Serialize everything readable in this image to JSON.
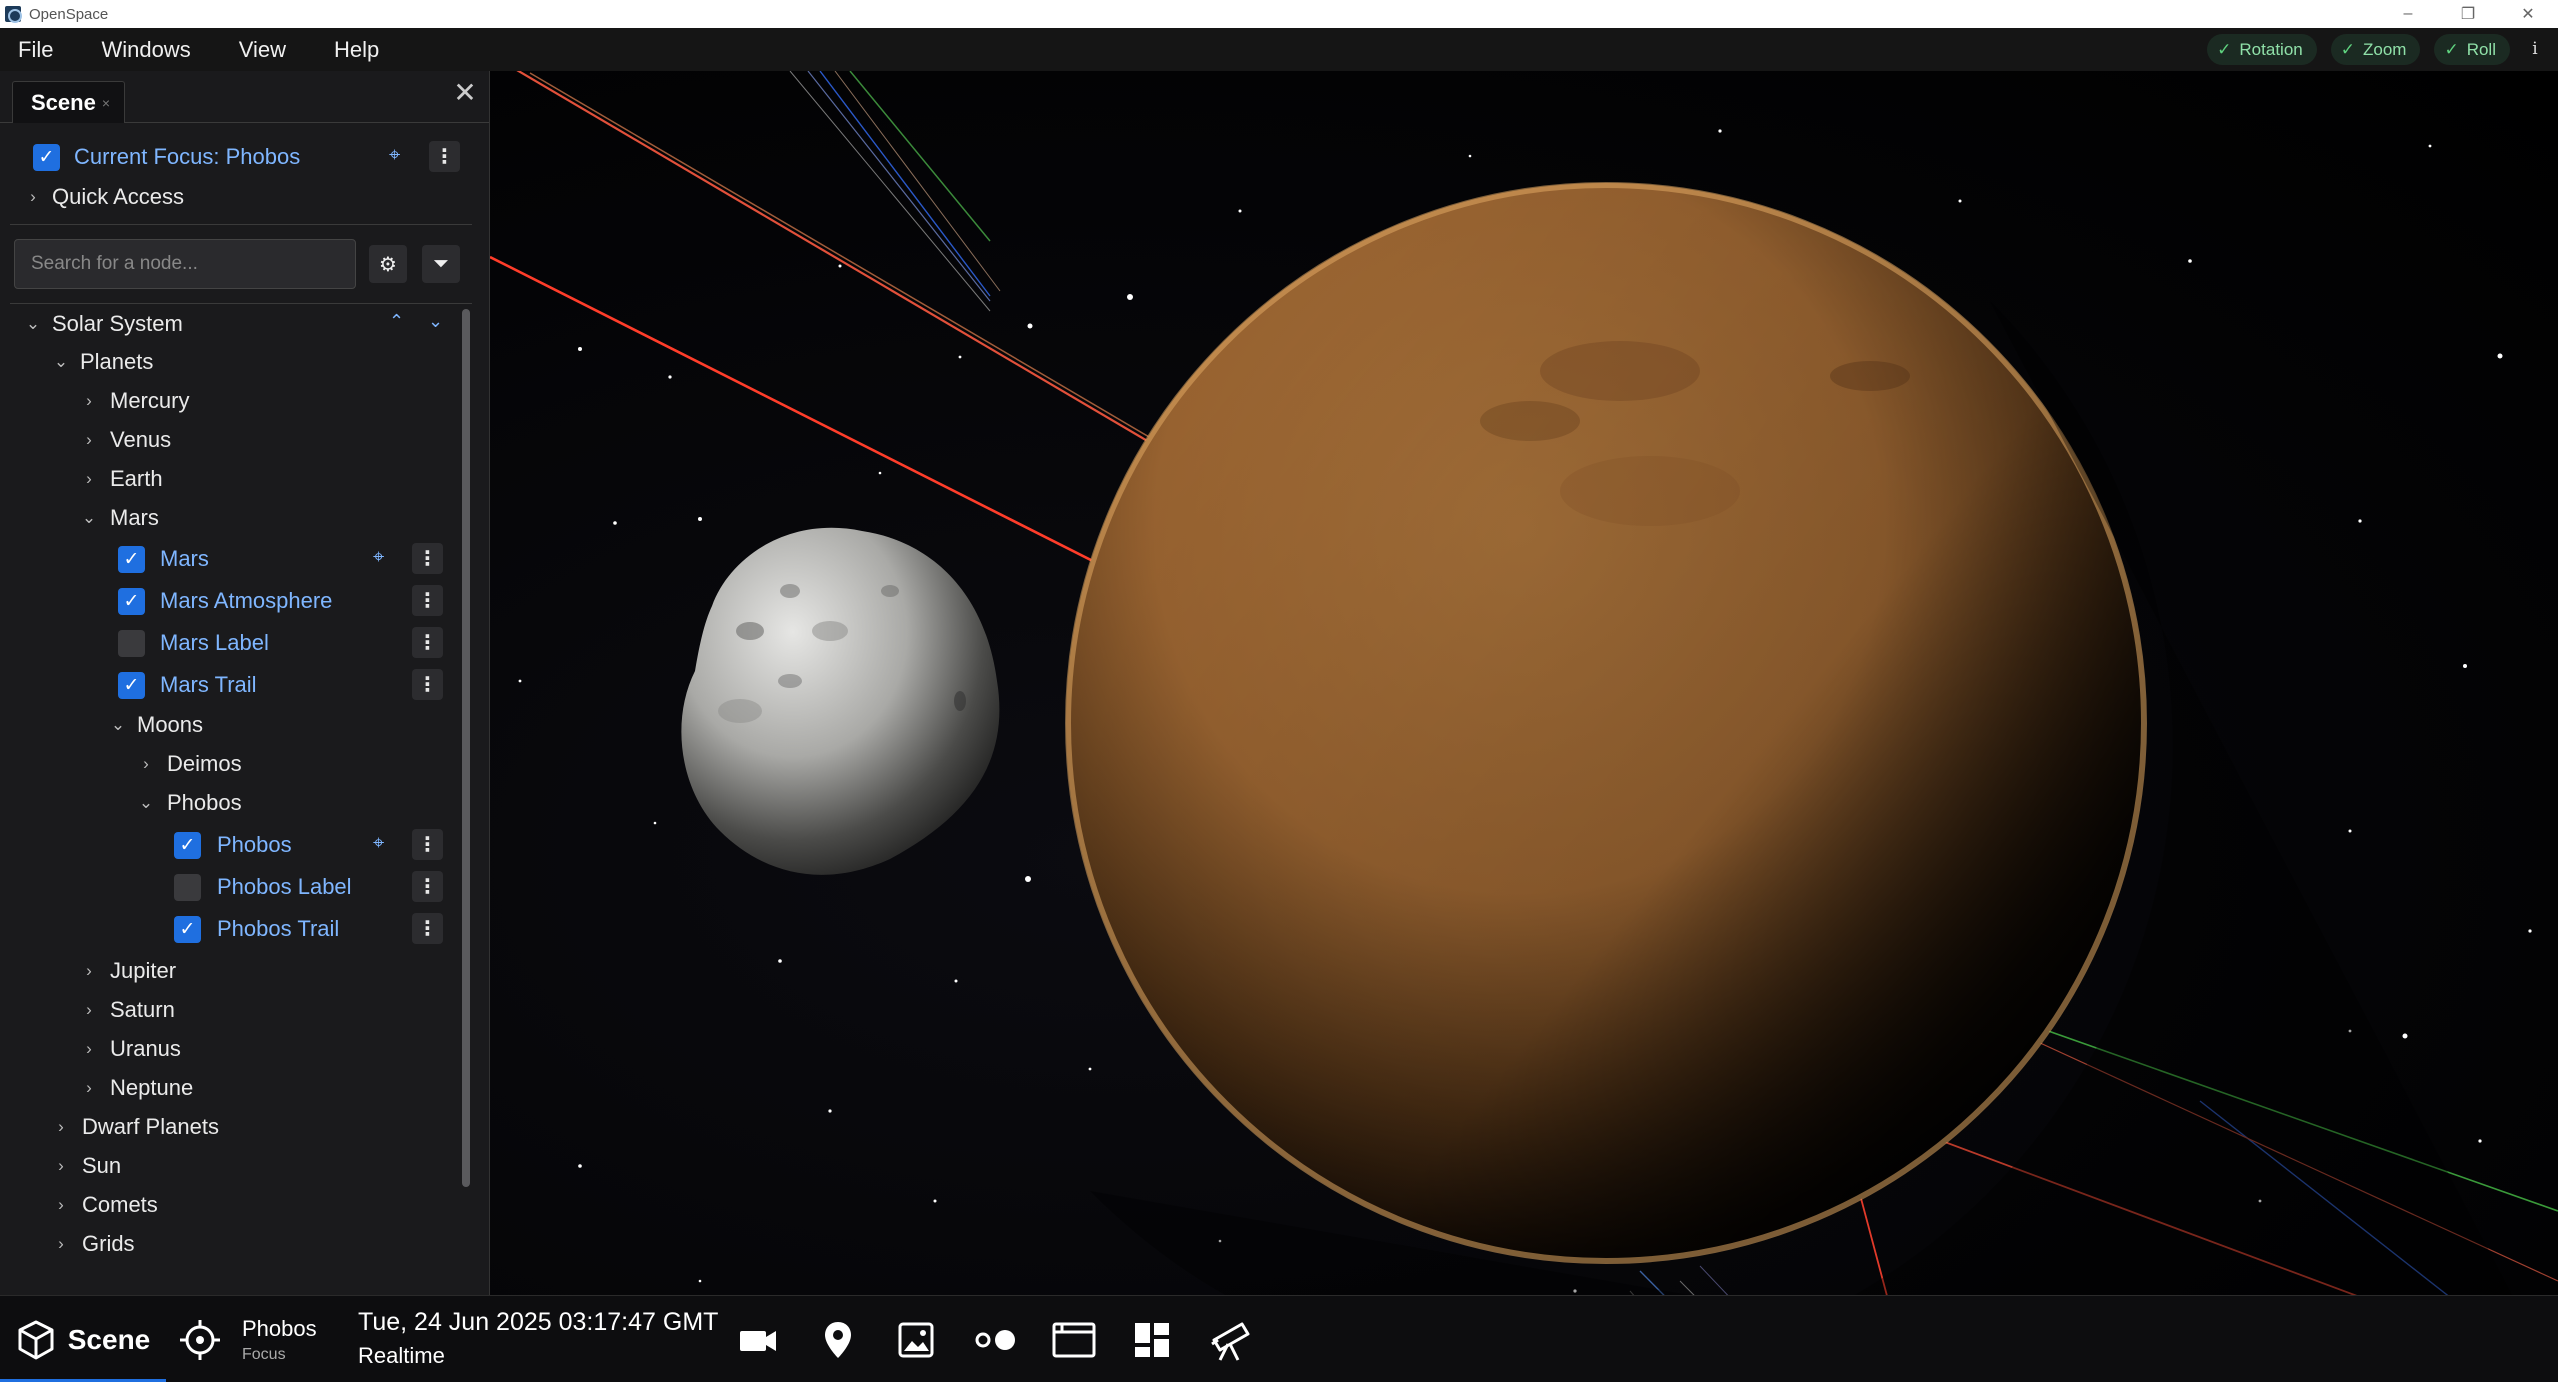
{
  "window": {
    "title": "OpenSpace",
    "minimize": "–",
    "restore": "❐",
    "close": "✕"
  },
  "menu": [
    "File",
    "Windows",
    "View",
    "Help"
  ],
  "nav_toggles": [
    {
      "label": "Rotation",
      "icon": "check-icon"
    },
    {
      "label": "Zoom",
      "icon": "check-icon"
    },
    {
      "label": "Roll",
      "icon": "check-icon"
    }
  ],
  "info_label": "i",
  "panel": {
    "tab_label": "Scene",
    "tab_close": "×",
    "close": "✕",
    "current_focus": "Current Focus: Phobos",
    "quick_access": "Quick Access",
    "search_placeholder": "Search for a node...",
    "tree": {
      "solar_system": "Solar System",
      "planets": "Planets",
      "mercury": "Mercury",
      "venus": "Venus",
      "earth": "Earth",
      "mars_group": "Mars",
      "mars": "Mars",
      "mars_atmosphere": "Mars Atmosphere",
      "mars_label": "Mars Label",
      "mars_trail": "Mars Trail",
      "moons": "Moons",
      "deimos": "Deimos",
      "phobos_group": "Phobos",
      "phobos": "Phobos",
      "phobos_label": "Phobos Label",
      "phobos_trail": "Phobos Trail",
      "jupiter": "Jupiter",
      "saturn": "Saturn",
      "uranus": "Uranus",
      "neptune": "Neptune",
      "dwarf_planets": "Dwarf Planets",
      "sun": "Sun",
      "comets": "Comets",
      "grids": "Grids"
    }
  },
  "bottom": {
    "scene": "Scene",
    "focus_name": "Phobos",
    "focus_sub": "Focus",
    "date": "Tue, 24 Jun 2025 03:17:47 GMT",
    "time_mode": "Realtime"
  },
  "colors": {
    "accent": "#1f6fe0",
    "link_blue": "#7fb6ff",
    "toggle_green": "#5fd27f",
    "mars": "#b87a35"
  }
}
